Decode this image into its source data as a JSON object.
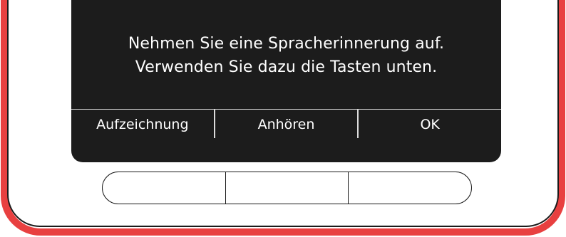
{
  "screen": {
    "message_line1": "Nehmen Sie eine Spracherinnerung auf.",
    "message_line2": "Verwenden Sie dazu die Tasten unten."
  },
  "softkeys": {
    "left": "Aufzeichnung",
    "middle": "Anhören",
    "right": "OK"
  },
  "colors": {
    "frame": "#e84040",
    "screen_background": "#1c1c1c",
    "text": "#ffffff"
  }
}
